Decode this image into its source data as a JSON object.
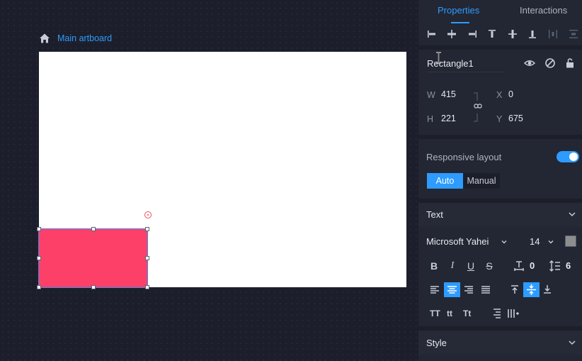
{
  "breadcrumb": {
    "label": "Main artboard"
  },
  "tabs": {
    "properties": "Properties",
    "interactions": "Interactions"
  },
  "layer": {
    "name": "Rectangle1"
  },
  "dimensions": {
    "w_label": "W",
    "w_value": "415",
    "h_label": "H",
    "h_value": "221",
    "x_label": "X",
    "x_value": "0",
    "y_label": "Y",
    "y_value": "675"
  },
  "responsive": {
    "label": "Responsive layout",
    "enabled": true,
    "auto": "Auto",
    "manual": "Manual"
  },
  "text_section": {
    "title": "Text",
    "font_family": "Microsoft Yahei",
    "font_size": "14",
    "letter_spacing": "0",
    "line_height": "6",
    "bold": "B",
    "italic": "I",
    "underline": "U",
    "strike": "S",
    "case_upper": "TT",
    "case_lower": "tt",
    "case_title": "Tt"
  },
  "style_section": {
    "title": "Style"
  },
  "colors": {
    "accent": "#2e9bff",
    "shape_fill": "#fd4067",
    "font_color": "#8e8e8e"
  }
}
